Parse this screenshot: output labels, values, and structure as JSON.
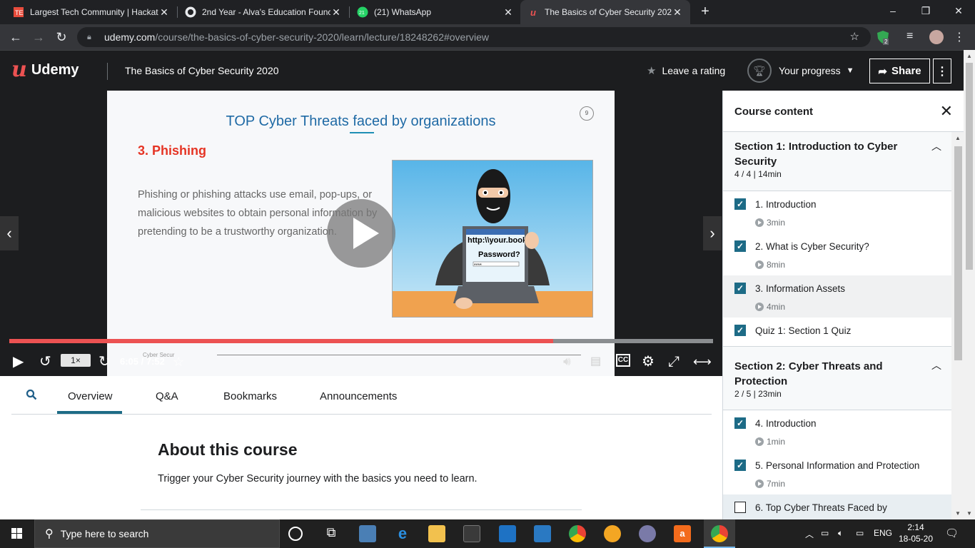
{
  "browser": {
    "tabs": [
      {
        "title": "Largest Tech Community | Hackat",
        "favicon": "hackathon-favicon"
      },
      {
        "title": "2nd Year - Alva's Education Founc",
        "favicon": "github-icon"
      },
      {
        "title": "(21) WhatsApp",
        "favicon": "whatsapp-icon"
      },
      {
        "title": "The Basics of Cyber Security 2020",
        "favicon": "udemy-icon"
      }
    ],
    "url_host": "udemy.com",
    "url_path": "/course/the-basics-of-cyber-security-2020/learn/lecture/18248262#overview",
    "window_controls": [
      "–",
      "❐",
      "✕"
    ],
    "ext_badge": "2"
  },
  "header": {
    "logo_text": "Udemy",
    "course_title": "The Basics of Cyber Security 2020",
    "leave_rating": "Leave a rating",
    "your_progress": "Your progress",
    "share": "Share"
  },
  "slide": {
    "title": "TOP Cyber Threats faced by organizations",
    "slide_number": "9",
    "heading": "3. Phishing",
    "body": "Phishing or phishing attacks use email, pop-ups, or malicious websites to obtain personal information by pretending to be a trustworthy organization.",
    "image_url_text": "http:\\\\your.book",
    "image_password_text": "Password?",
    "image_password_mask": "****"
  },
  "player": {
    "progress": 0.773,
    "speed": "1×",
    "time": "6:05 / 7:52",
    "cc": "CC",
    "watermark": "Cyber Secur"
  },
  "subtabs": {
    "overview": "Overview",
    "qa": "Q&A",
    "bookmarks": "Bookmarks",
    "announcements": "Announcements"
  },
  "about": {
    "title": "About this course",
    "text": "Trigger your Cyber Security journey with the basics you need to learn."
  },
  "sidebar": {
    "title": "Course content",
    "sections": [
      {
        "name": "Section 1: Introduction to Cyber Security",
        "meta": "4 / 4 | 14min",
        "lectures": [
          {
            "title": "1. Introduction",
            "duration": "3min",
            "done": true
          },
          {
            "title": "2. What is Cyber Security?",
            "duration": "8min",
            "done": true
          },
          {
            "title": "3. Information Assets",
            "duration": "4min",
            "done": true
          },
          {
            "title": "Quiz 1: Section 1 Quiz",
            "duration": "",
            "done": true
          }
        ]
      },
      {
        "name": "Section 2: Cyber Threats and Protection",
        "meta": "2 / 5 | 23min",
        "lectures": [
          {
            "title": "4. Introduction",
            "duration": "1min",
            "done": true
          },
          {
            "title": "5. Personal Information and Protection",
            "duration": "7min",
            "done": true
          },
          {
            "title": "6. Top Cyber Threats Faced by",
            "duration": "",
            "done": false
          }
        ]
      }
    ]
  },
  "taskbar": {
    "search_placeholder": "Type here to search",
    "lang": "ENG",
    "time": "2:14",
    "date": "18-05-20"
  }
}
